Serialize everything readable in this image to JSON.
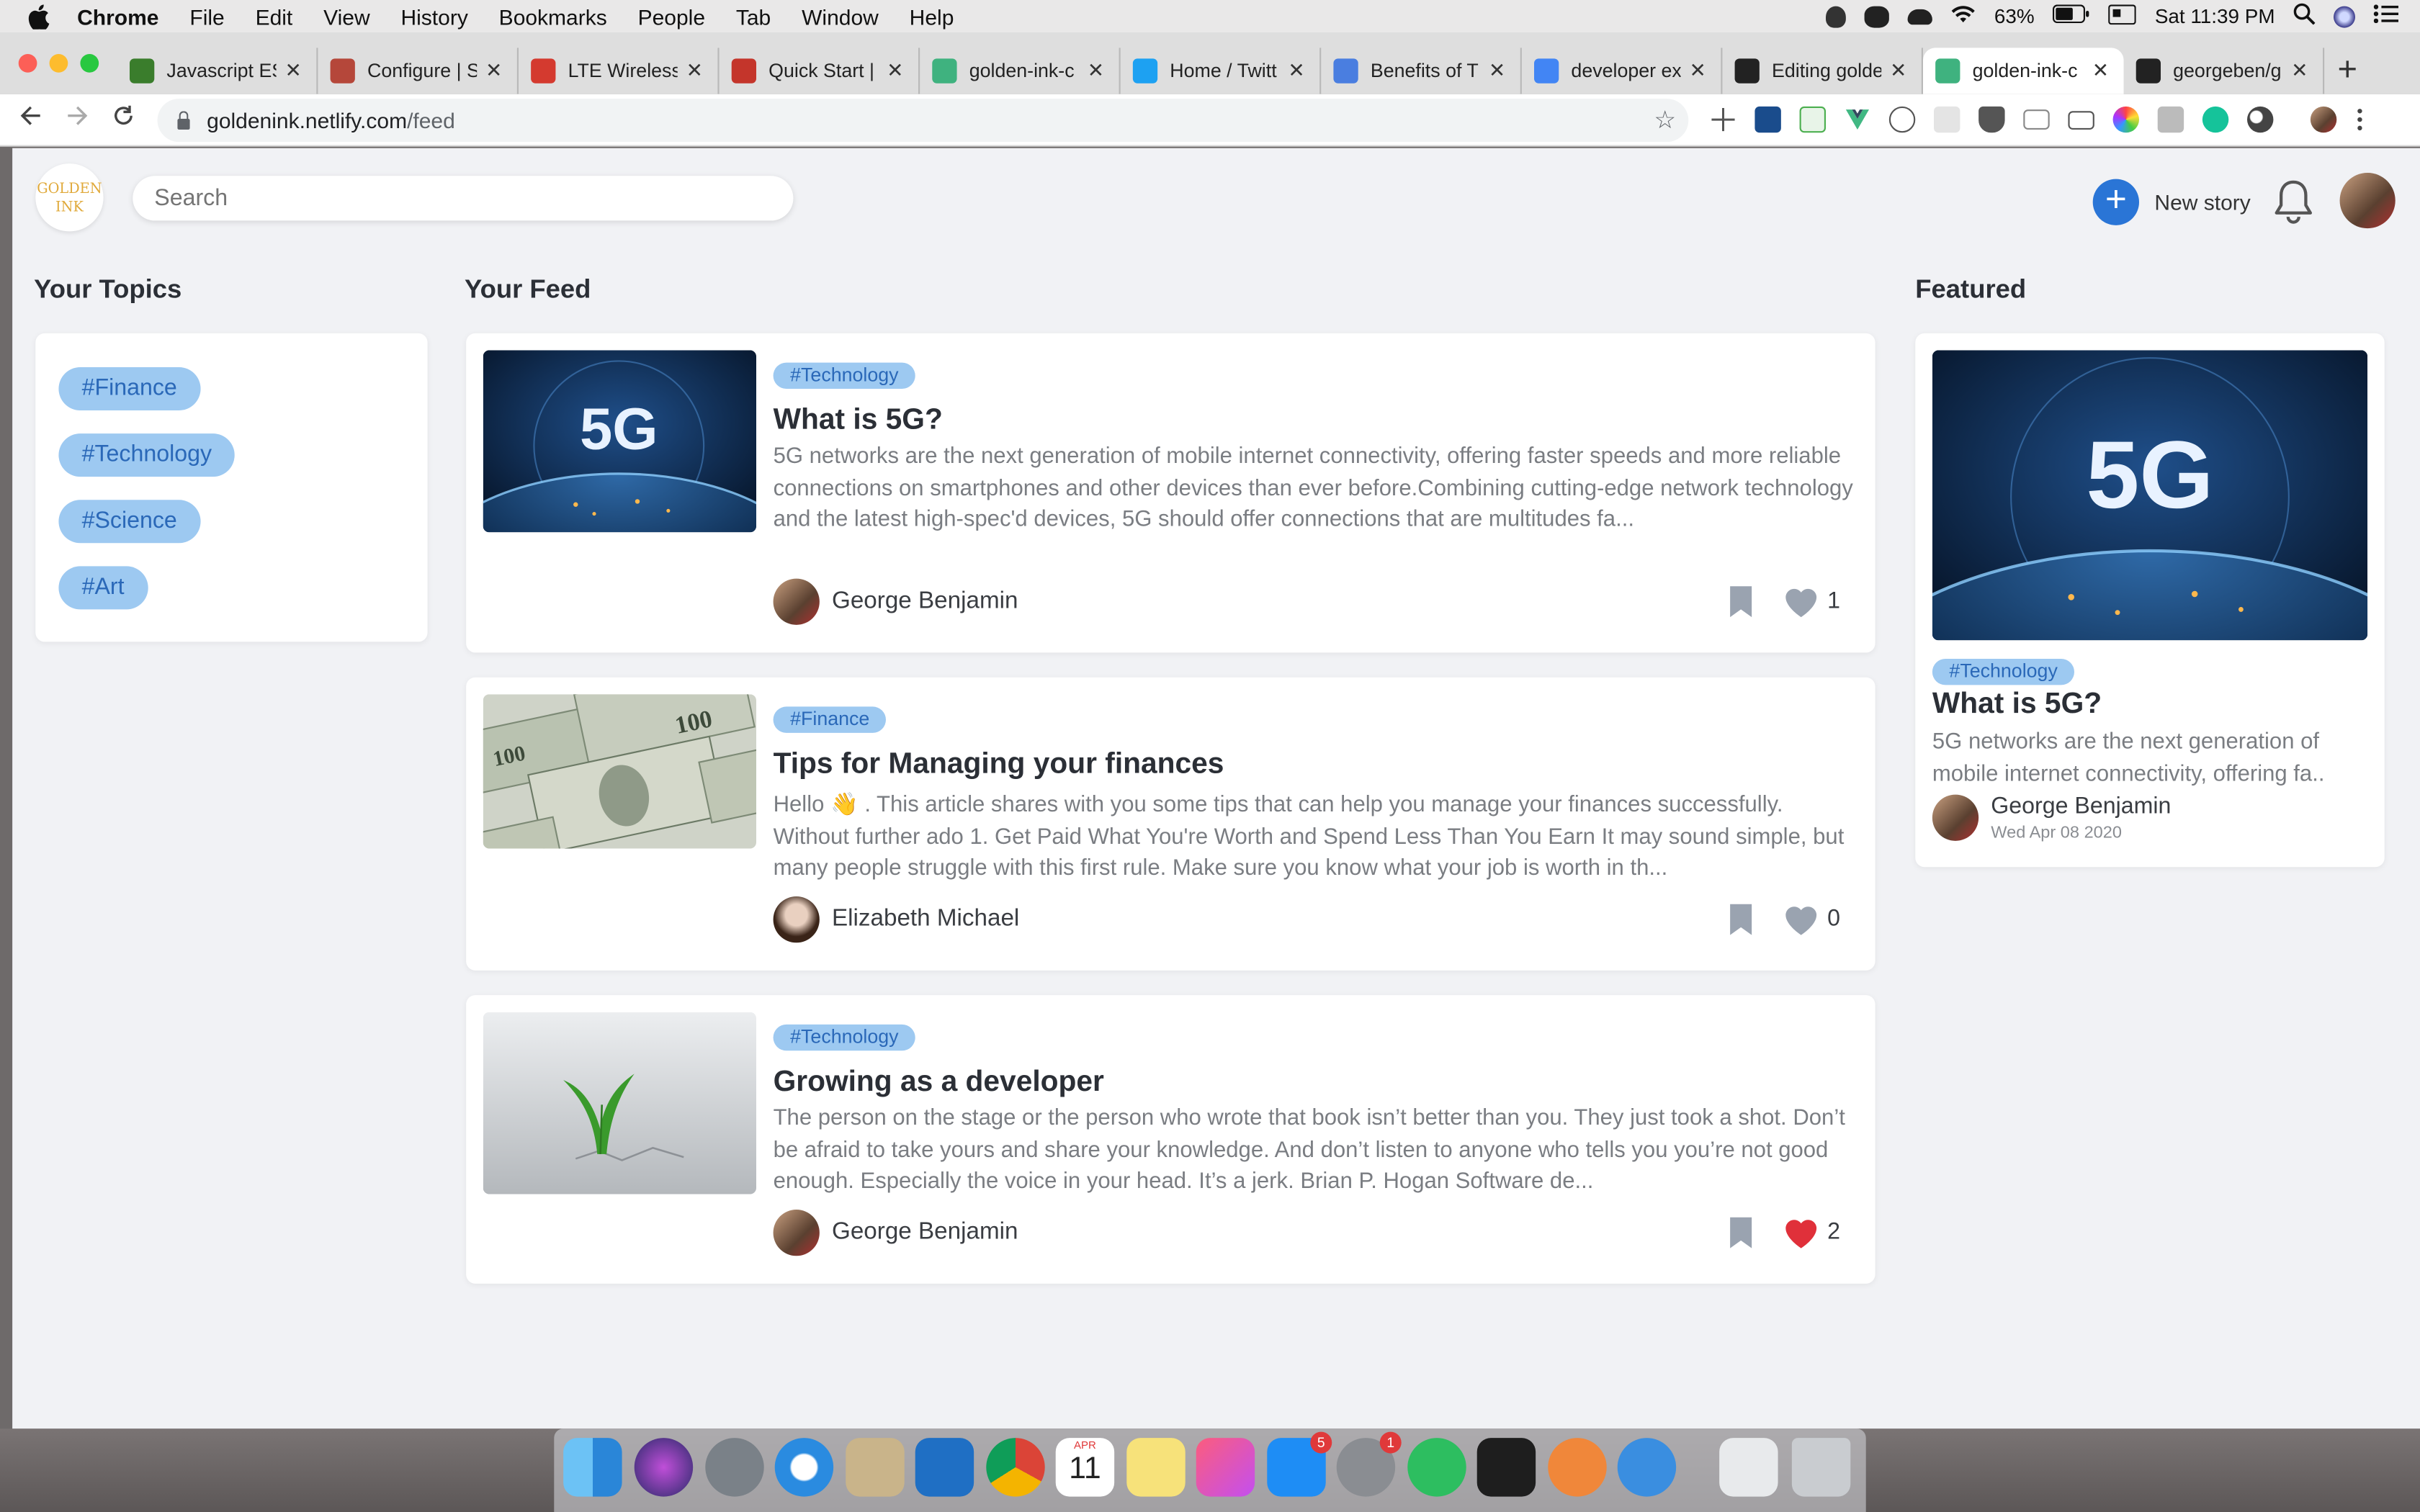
{
  "menubar": {
    "app": "Chrome",
    "items": [
      "File",
      "Edit",
      "View",
      "History",
      "Bookmarks",
      "People",
      "Tab",
      "Window",
      "Help"
    ],
    "battery": "63%",
    "clock": "Sat 11:39 PM"
  },
  "tabs": [
    {
      "label": "Javascript ES",
      "color": "#3a7d2c"
    },
    {
      "label": "Configure | S",
      "color": "#b5473a"
    },
    {
      "label": "LTE Wireless",
      "color": "#d43a2f"
    },
    {
      "label": "Quick Start |",
      "color": "#c4352b"
    },
    {
      "label": "golden-ink-c",
      "color": "#3fb27f"
    },
    {
      "label": "Home / Twitt",
      "color": "#1da1f2"
    },
    {
      "label": "Benefits of T",
      "color": "#4a7ee0"
    },
    {
      "label": "developer ex",
      "color": "#4285f4"
    },
    {
      "label": "Editing golde",
      "color": "#222222"
    },
    {
      "label": "golden-ink-c",
      "color": "#3fb27f",
      "active": true
    },
    {
      "label": "georgeben/g",
      "color": "#222222"
    }
  ],
  "address": {
    "host": "goldenink.netlify.com",
    "path": "/feed"
  },
  "header": {
    "logo_line1": "GOLDEN",
    "logo_line2": "INK",
    "search_placeholder": "Search",
    "new_story": "New story"
  },
  "topics": {
    "title": "Your Topics",
    "items": [
      "#Finance",
      "#Technology",
      "#Science",
      "#Art"
    ]
  },
  "feed": {
    "title": "Your Feed",
    "posts": [
      {
        "tag": "#Technology",
        "title": "What is 5G?",
        "excerpt": "5G networks are the next generation of mobile internet connectivity, offering faster speeds and more reliable connections on smartphones and other devices than ever before.Combining cutting-edge network technology and the latest high-spec'd devices, 5G should offer connections that are multitudes fa...",
        "author": "George Benjamin",
        "likes": "1",
        "liked": false,
        "image": "5G"
      },
      {
        "tag": "#Finance",
        "title": "Tips for Managing your finances",
        "excerpt": "Hello 👋 . This article shares with you some tips that can help you manage your finances successfully. Without further ado 1. Get Paid What You're Worth and Spend Less Than You Earn It may sound simple, but many people struggle with this first rule. Make sure you know what your job is worth in th...",
        "author": "Elizabeth Michael",
        "likes": "0",
        "liked": false
      },
      {
        "tag": "#Technology",
        "title": "Growing as a developer",
        "excerpt": "The person on the stage or the person who wrote that book isn’t better than you. They just took a shot. Don’t be afraid to take yours and share your knowledge. And don’t listen to anyone who tells you you’re not good enough. Especially the voice in your head. It’s a jerk. Brian P. Hogan Software de...",
        "author": "George Benjamin",
        "likes": "2",
        "liked": true
      }
    ]
  },
  "featured": {
    "title": "Featured",
    "tag": "#Technology",
    "post_title": "What is 5G?",
    "excerpt": "5G networks are the next generation of mobile internet connectivity, offering fa..",
    "author": "George Benjamin",
    "date": "Wed Apr 08 2020",
    "image": "5G"
  },
  "dock": {
    "calendar_month": "APR",
    "calendar_day": "11",
    "appstore_badge": "5",
    "settings_badge": "1"
  },
  "colors": {
    "accent": "#2a75d6",
    "pill_bg": "#9dc9f1",
    "pill_text": "#2a68b8",
    "heart_liked": "#e0303a",
    "heart_unliked": "#9aa3b0"
  }
}
